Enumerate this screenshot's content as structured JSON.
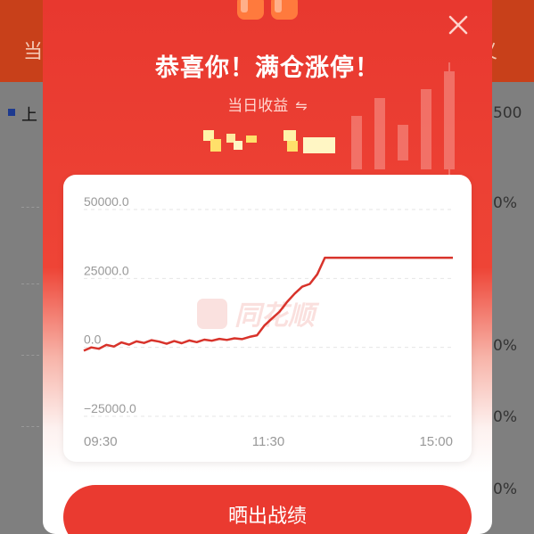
{
  "background": {
    "header_left": "当",
    "header_right": "义",
    "chart_title": "上",
    "side_labels": [
      "500",
      "0%",
      "0%",
      "0%",
      "0%"
    ]
  },
  "modal": {
    "title": "恭喜你！满仓涨停！",
    "subtitle": "当日收益",
    "swap_icon": "⇋",
    "share_button": "晒出战绩",
    "watermark": "同花顺",
    "colors": {
      "accent": "#ea3a30",
      "line": "#d8332b",
      "title_text": "#ffffff"
    }
  },
  "chart_data": {
    "type": "line",
    "y_tick_labels": [
      "50000.0",
      "25000.0",
      "0.0",
      "−25000.0"
    ],
    "x_tick_labels": [
      "09:30",
      "11:30",
      "15:00"
    ],
    "ylim": [
      -25000,
      50000
    ],
    "x_points": 50,
    "series": [
      {
        "values": [
          -1200,
          0,
          -500,
          900,
          300,
          1800,
          1000,
          2200,
          1600,
          2600,
          2100,
          1300,
          2300,
          1500,
          2500,
          1900,
          2800,
          2400,
          3100,
          2700,
          3300,
          3000,
          3800,
          4400,
          8000,
          10500,
          13000,
          16500,
          19500,
          22000,
          23000,
          26500,
          32500,
          32500,
          32500,
          32500,
          32500,
          32500,
          32500,
          32500,
          32500,
          32500,
          32500,
          32500,
          32500,
          32500,
          32500,
          32500,
          32500,
          32500
        ]
      }
    ],
    "grid": true
  }
}
